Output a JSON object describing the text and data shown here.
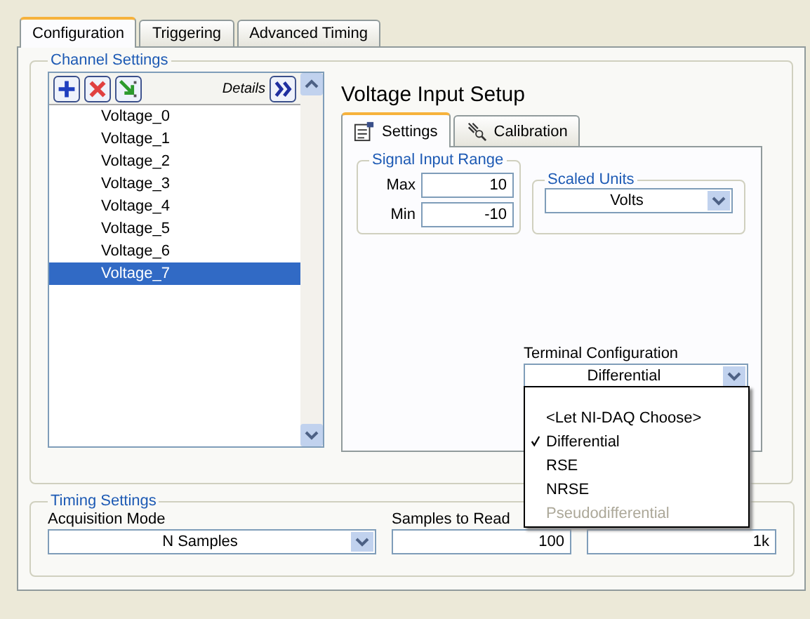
{
  "tabs": [
    {
      "label": "Configuration",
      "selected": true
    },
    {
      "label": "Triggering",
      "selected": false
    },
    {
      "label": "Advanced Timing",
      "selected": false
    }
  ],
  "channel_settings": {
    "title": "Channel Settings",
    "details_label": "Details",
    "channels": [
      {
        "name": "Voltage_0",
        "selected": false
      },
      {
        "name": "Voltage_1",
        "selected": false
      },
      {
        "name": "Voltage_2",
        "selected": false
      },
      {
        "name": "Voltage_3",
        "selected": false
      },
      {
        "name": "Voltage_4",
        "selected": false
      },
      {
        "name": "Voltage_5",
        "selected": false
      },
      {
        "name": "Voltage_6",
        "selected": false
      },
      {
        "name": "Voltage_7",
        "selected": true
      }
    ]
  },
  "setup": {
    "title": "Voltage Input Setup",
    "tabs": [
      {
        "label": "Settings",
        "selected": true
      },
      {
        "label": "Calibration",
        "selected": false
      }
    ],
    "signal_input_range": {
      "title": "Signal Input Range",
      "max_label": "Max",
      "max": "10",
      "min_label": "Min",
      "min": "-10"
    },
    "scaled_units": {
      "title": "Scaled Units",
      "value": "Volts"
    },
    "terminal_configuration": {
      "label": "Terminal Configuration",
      "value": "Differential",
      "options": [
        {
          "label": "<Let NI-DAQ Choose>",
          "selected": false,
          "disabled": false
        },
        {
          "label": "Differential",
          "selected": true,
          "disabled": false
        },
        {
          "label": "RSE",
          "selected": false,
          "disabled": false
        },
        {
          "label": "NRSE",
          "selected": false,
          "disabled": false
        },
        {
          "label": "Pseudodifferential",
          "selected": false,
          "disabled": true
        }
      ]
    }
  },
  "timing_settings": {
    "title": "Timing Settings",
    "acquisition_mode_label": "Acquisition Mode",
    "acquisition_mode": "N Samples",
    "samples_label": "Samples to Read",
    "samples": "100",
    "rate": "1k"
  }
}
